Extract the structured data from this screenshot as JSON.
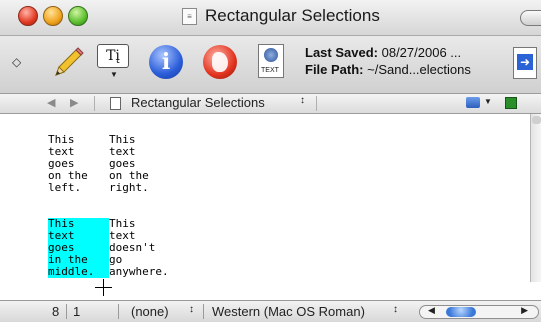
{
  "window": {
    "title": "Rectangular Selections"
  },
  "toolbar": {
    "last_saved_label": "Last Saved:",
    "last_saved_value": "08/27/2006 ...",
    "file_path_label": "File Path:",
    "file_path_value": "~/Sand...elections",
    "text_tool_glyph": "Tį",
    "textdoc_label": "TEXT",
    "info_glyph": "i",
    "icons": [
      "diamond-icon",
      "pencil-icon",
      "text-options-icon",
      "info-icon",
      "globe-icon",
      "text-document-icon",
      "more-tools-icon"
    ]
  },
  "navbar": {
    "document_title": "Rectangular Selections",
    "back_glyph": "◀",
    "forward_glyph": "▶",
    "updown_glyph": "↕"
  },
  "editor": {
    "left_column": [
      "This",
      "text",
      "goes",
      "on the",
      "left."
    ],
    "right_column": [
      "This",
      "text",
      "goes",
      "on the",
      "right."
    ],
    "left_column_2": [
      "This",
      "text",
      "goes",
      "in the",
      "middle."
    ],
    "right_column_2": [
      "This",
      "text",
      "doesn't",
      "go",
      "anywhere."
    ],
    "highlight_color": "#00ffff"
  },
  "statusbar": {
    "line": "8",
    "column": "1",
    "language": "(none)",
    "encoding": "Western (Mac OS Roman)",
    "updown_glyph": "↕"
  }
}
